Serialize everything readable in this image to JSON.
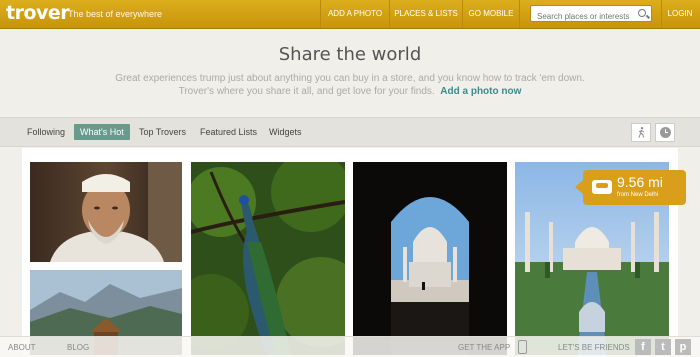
{
  "header": {
    "logo": "trover",
    "tagline": "The best of everywhere",
    "nav": [
      "ADD A PHOTO",
      "PLACES & LISTS",
      "GO MOBILE"
    ],
    "search_placeholder": "Search places or interests",
    "login": "LOGIN"
  },
  "hero": {
    "title": "Share the world",
    "line1": "Great experiences trump just about anything you can buy in a store, and you know how to track 'em down.",
    "line2": "Trover's where you share it all, and get love for your finds.",
    "cta": "Add a photo now"
  },
  "tabs": [
    {
      "label": "Following",
      "active": false
    },
    {
      "label": "What's Hot",
      "active": true
    },
    {
      "label": "Top Trovers",
      "active": false
    },
    {
      "label": "Featured Lists",
      "active": false
    },
    {
      "label": "Widgets",
      "active": false
    }
  ],
  "distance": {
    "value": "9.56 mi",
    "sub": "from New Delhi"
  },
  "footer": {
    "about": "ABOUT",
    "blog": "BLOG",
    "get_app": "GET THE APP",
    "friends": "LET'S BE FRIENDS",
    "social": [
      "f",
      "t",
      "p"
    ]
  },
  "colors": {
    "header": "#d3a217",
    "accent": "#3e8a8a",
    "active_tab": "#6a9a8c",
    "badge": "#d99f1a"
  },
  "icons": [
    "search-icon",
    "walk-icon",
    "clock-icon",
    "car-icon",
    "phone-icon",
    "facebook-icon",
    "twitter-icon",
    "pinterest-icon"
  ]
}
